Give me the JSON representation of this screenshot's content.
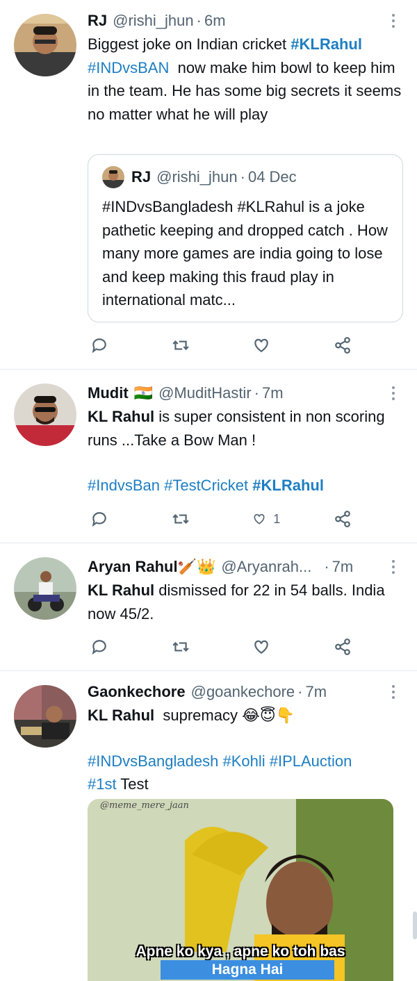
{
  "tweets": [
    {
      "name": "RJ",
      "handle": "@rishi_jhun",
      "time": "6m",
      "text_parts": [
        {
          "t": "Biggest joke on Indian cricket ",
          "c": "text"
        },
        {
          "t": "#KLRahul",
          "c": "tag bold"
        },
        {
          "t": "#INDvsBAN",
          "c": "tag"
        },
        {
          "t": "  now make him bowl to keep him in the team. He has some big secrets it seems no matter what he will play",
          "c": "text"
        }
      ],
      "quote": {
        "name": "RJ",
        "handle": "@rishi_jhun",
        "date": "04 Dec",
        "text": "#INDvsBangladesh #KLRahul is a joke pathetic keeping and dropped catch . How many more games are india going to lose and keep making this fraud play in international matc..."
      },
      "like_count": ""
    },
    {
      "name": "Mudit",
      "flag": "🇮🇳",
      "handle": "@MuditHastir",
      "time": "7m",
      "text_bold": "KL Rahul",
      "text_rest": " is super consistent in non scoring runs ...Take a Bow Man !",
      "tags": [
        "#IndvsBan",
        "#TestCricket",
        "#KLRahul"
      ],
      "like_count": "1"
    },
    {
      "name": "Aryan Rahul",
      "emoji": "🏏👑",
      "handle": "@Aryanrah...",
      "time": "7m",
      "text_bold": "KL Rahul",
      "text_rest": " dismissed for 22 in 54 balls. India now 45/2.",
      "like_count": ""
    },
    {
      "name": "Gaonkechore",
      "handle": "@goankechore",
      "time": "7m",
      "text_bold": "KL Rahul",
      "text_rest": "  supremacy 😂😇👇",
      "tags": [
        "#INDvsBangladesh",
        "#Kohli",
        "#IPLAuction",
        "#1st"
      ],
      "tag_tail": " Test",
      "meme": {
        "watermark": "@meme_mere_jaan",
        "caption_line1": "Apne ko kya , apne ko toh bas",
        "caption_line2": "Hagna Hai"
      }
    }
  ],
  "separator": "·",
  "colors": {
    "accent": "#1d7ec2",
    "muted": "#536471",
    "border": "#e6ecf0"
  }
}
